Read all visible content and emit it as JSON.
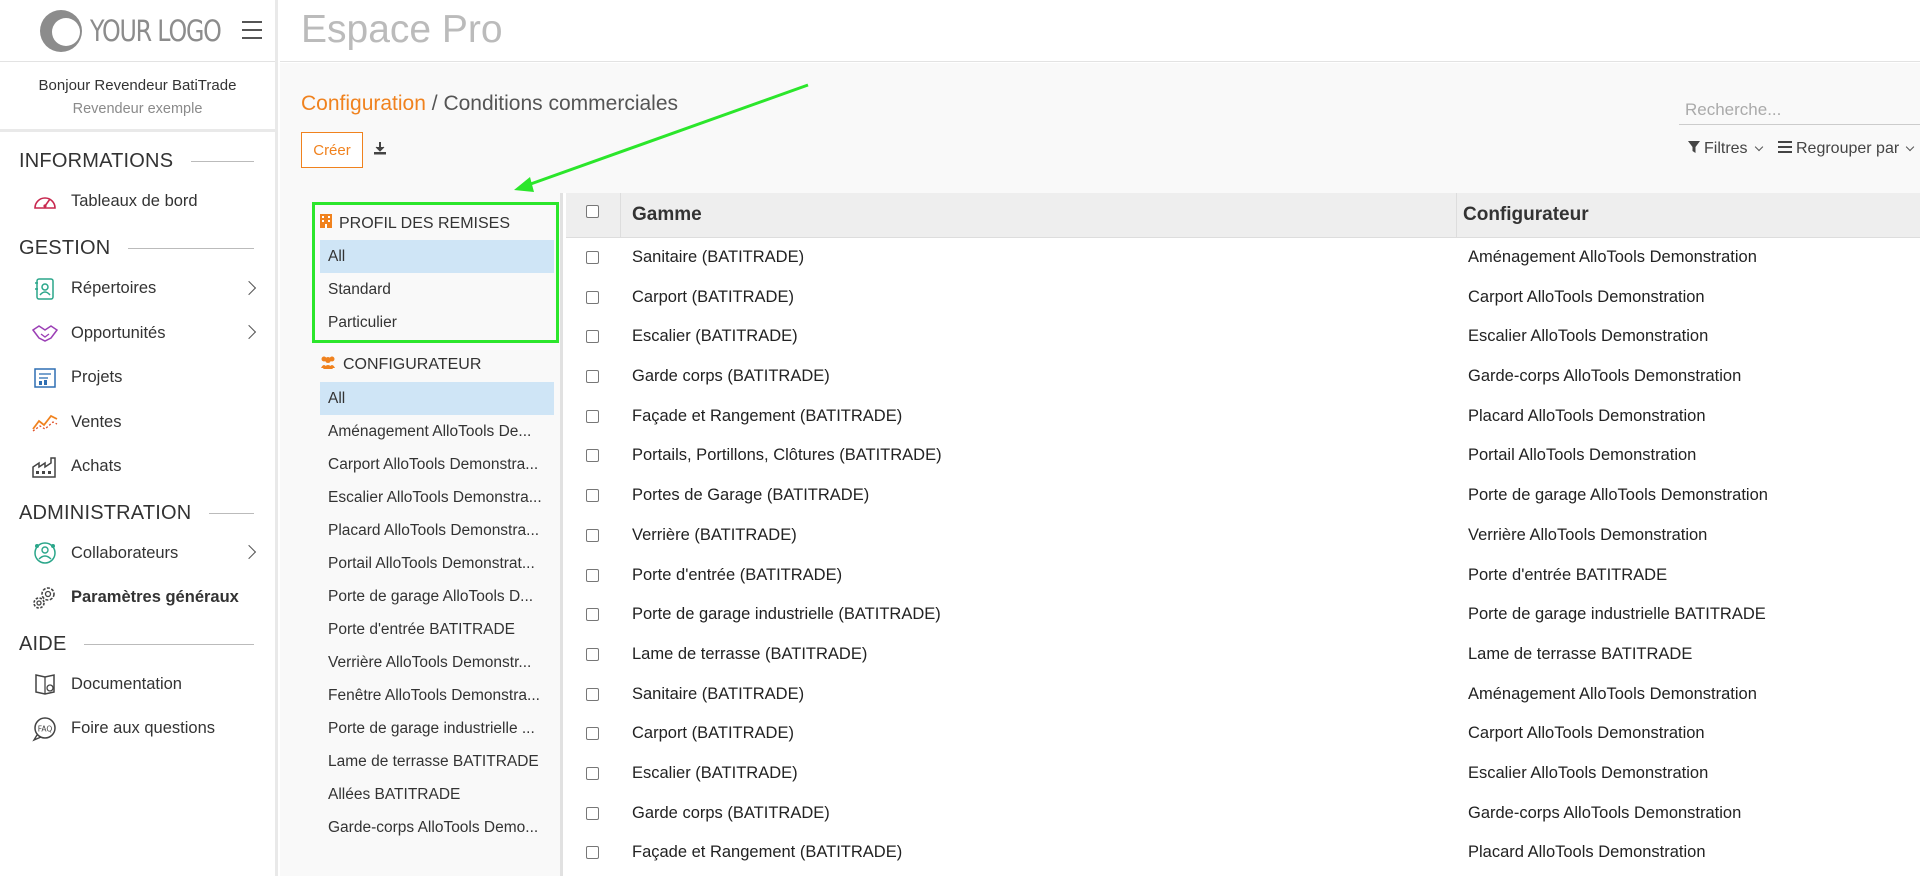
{
  "logo": {
    "text": "YOUR LOGO"
  },
  "greeting": {
    "line1": "Bonjour Revendeur BatiTrade",
    "line2": "Revendeur exemple"
  },
  "app": {
    "title": "Espace Pro"
  },
  "nav": {
    "sections": [
      {
        "title": "INFORMATIONS",
        "items": [
          {
            "label": "Tableaux de bord",
            "icon": "dashboard-gauge-icon"
          }
        ]
      },
      {
        "title": "GESTION",
        "items": [
          {
            "label": "Répertoires",
            "icon": "contacts-directory-icon"
          },
          {
            "label": "Opportunités",
            "icon": "handshake-icon"
          },
          {
            "label": "Projets",
            "icon": "project-board-icon"
          },
          {
            "label": "Ventes",
            "icon": "sales-trend-icon"
          },
          {
            "label": "Achats",
            "icon": "factory-icon"
          }
        ]
      },
      {
        "title": "ADMINISTRATION",
        "items": [
          {
            "label": "Collaborateurs",
            "icon": "team-globe-icon"
          },
          {
            "label": "Paramètres généraux",
            "icon": "gears-icon"
          }
        ]
      },
      {
        "title": "AIDE",
        "items": [
          {
            "label": "Documentation",
            "icon": "book-icon"
          },
          {
            "label": "Foire aux questions",
            "icon": "faq-bubble-icon"
          }
        ]
      }
    ]
  },
  "breadcrumb": {
    "parent": "Configuration",
    "separator": " / ",
    "current": "Conditions commerciales"
  },
  "toolbar": {
    "create_label": "Créer",
    "filters_label": "Filtres",
    "group_label": "Regrouper par"
  },
  "search": {
    "placeholder": "Recherche..."
  },
  "panel": {
    "profil": {
      "title": "PROFIL DES REMISES",
      "items": [
        "All",
        "Standard",
        "Particulier"
      ]
    },
    "configurateur": {
      "title": "CONFIGURATEUR",
      "items": [
        "All",
        "Aménagement AlloTools De...",
        "Carport AlloTools Demonstra...",
        "Escalier AlloTools Demonstra...",
        "Placard AlloTools Demonstra...",
        "Portail AlloTools Demonstrat...",
        "Porte de garage AlloTools D...",
        "Porte d'entrée BATITRADE",
        "Verrière AlloTools Demonstr...",
        "Fenêtre AlloTools Demonstra...",
        "Porte de garage industrielle ...",
        "Lame de terrasse BATITRADE",
        "Allées BATITRADE",
        "Garde-corps AlloTools Demo..."
      ]
    }
  },
  "table": {
    "headers": [
      "Gamme",
      "Configurateur"
    ],
    "rows": [
      [
        "Sanitaire (BATITRADE)",
        "Aménagement AlloTools Demonstration"
      ],
      [
        "Carport (BATITRADE)",
        "Carport AlloTools Demonstration"
      ],
      [
        "Escalier (BATITRADE)",
        "Escalier AlloTools Demonstration"
      ],
      [
        "Garde corps (BATITRADE)",
        "Garde-corps AlloTools Demonstration"
      ],
      [
        "Façade et Rangement (BATITRADE)",
        "Placard AlloTools Demonstration"
      ],
      [
        "Portails, Portillons, Clôtures (BATITRADE)",
        "Portail AlloTools Demonstration"
      ],
      [
        "Portes de Garage (BATITRADE)",
        "Porte de garage AlloTools Demonstration"
      ],
      [
        "Verrière (BATITRADE)",
        "Verrière AlloTools Demonstration"
      ],
      [
        "Porte d'entrée (BATITRADE)",
        "Porte d'entrée BATITRADE"
      ],
      [
        "Porte de garage industrielle (BATITRADE)",
        "Porte de garage industrielle BATITRADE"
      ],
      [
        "Lame de terrasse (BATITRADE)",
        "Lame de terrasse BATITRADE"
      ],
      [
        "Sanitaire (BATITRADE)",
        "Aménagement AlloTools Demonstration"
      ],
      [
        "Carport (BATITRADE)",
        "Carport AlloTools Demonstration"
      ],
      [
        "Escalier (BATITRADE)",
        "Escalier AlloTools Demonstration"
      ],
      [
        "Garde corps (BATITRADE)",
        "Garde-corps AlloTools Demonstration"
      ],
      [
        "Façade et Rangement (BATITRADE)",
        "Placard AlloTools Demonstration"
      ]
    ]
  },
  "colors": {
    "accent": "#f0821e",
    "selected": "#cfe5f6",
    "highlight_box": "#2be62b"
  }
}
